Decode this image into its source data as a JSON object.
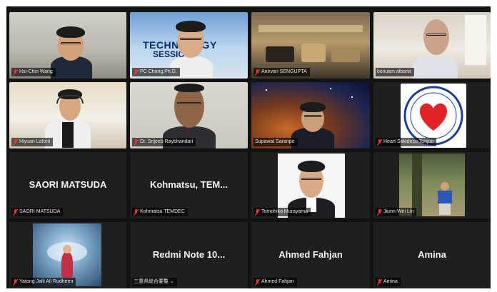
{
  "app": {
    "title": ""
  },
  "colors": {
    "active_speaker_outline": "#d7d22c",
    "muted_mic": "#e53935",
    "tile_bg": "#1f1f1f"
  },
  "tiles": [
    {
      "name": "Hsi-Chin Wang",
      "big_label": "",
      "muted": true,
      "active": true,
      "kind": "video"
    },
    {
      "name": "PC Chang,Ph.D.",
      "big_label": "",
      "muted": true,
      "active": false,
      "kind": "video",
      "banner_line1": "TECHNOLOGY",
      "banner_line2": "SESSION"
    },
    {
      "name": "Anirvan SENGUPTA",
      "big_label": "",
      "muted": true,
      "active": false,
      "kind": "video"
    },
    {
      "name": "bosuam albarla",
      "big_label": "",
      "muted": false,
      "active": false,
      "kind": "video"
    },
    {
      "name": "Hiyuan Lafont",
      "big_label": "",
      "muted": true,
      "active": false,
      "kind": "video"
    },
    {
      "name": "Dr. Srijeeb Raybhandari",
      "big_label": "",
      "muted": true,
      "active": false,
      "kind": "video"
    },
    {
      "name": "Supawat Saranpe",
      "big_label": "",
      "muted": false,
      "active": false,
      "kind": "video"
    },
    {
      "name": "Heart Sakidesu Tonjuo",
      "big_label": "",
      "muted": true,
      "active": false,
      "kind": "logo"
    },
    {
      "name": "SAORI MATSUDA",
      "big_label": "SAORI MATSUDA",
      "muted": true,
      "active": false,
      "kind": "name"
    },
    {
      "name": "Kohmatsu TEMDEC",
      "big_label": "Kohmatsu,  TEM...",
      "muted": true,
      "active": false,
      "kind": "name"
    },
    {
      "name": "Tomohiko Murayama",
      "big_label": "",
      "muted": true,
      "active": false,
      "kind": "portrait"
    },
    {
      "name": "Jiunn-Wei Lin",
      "big_label": "",
      "muted": true,
      "active": false,
      "kind": "photo"
    },
    {
      "name": "Yatong Jalil All Rudheen",
      "big_label": "",
      "muted": true,
      "active": false,
      "kind": "fantasy"
    },
    {
      "name": "三重県総合要覧 ⌄",
      "big_label": "Redmi Note 10...",
      "muted": false,
      "active": false,
      "kind": "name"
    },
    {
      "name": "Ahmed Fahjan",
      "big_label": "Ahmed Fahjan",
      "muted": true,
      "active": false,
      "kind": "name"
    },
    {
      "name": "Amina",
      "big_label": "Amina",
      "muted": true,
      "active": false,
      "kind": "name"
    }
  ]
}
